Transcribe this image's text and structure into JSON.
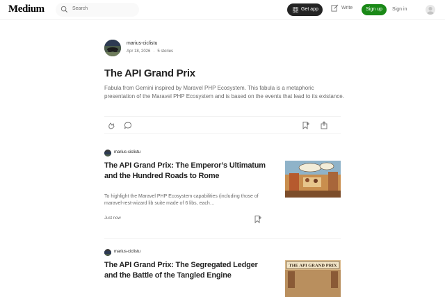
{
  "app": {
    "logo": "Medium",
    "search_placeholder": "Search",
    "get_app_label": "Get app",
    "write_label": "Write",
    "sign_up_label": "Sign up",
    "sign_in_label": "Sign in",
    "accent_color": "#1a8917"
  },
  "list": {
    "author": "marius-ciclistu",
    "date": "Apr 18, 2026",
    "stories_count": "5 stories",
    "title": "The API Grand Prix",
    "description": "Fabula from Gemini inspired by Maravel PHP Ecosystem. This fabula is a metaphoric presentation of the Maravel PHP Ecosystem and is based on the events that lead to its existance."
  },
  "stories": [
    {
      "author": "marius-ciclistu",
      "title": "The API Grand Prix: The Emperor’s Ultimatum and the Hundred Roads to Rome",
      "snippet": "To highlight the Maravel PHP Ecosystem capabilities (including those of maravel-rest-wizard lib suite made of 6 libs, each…",
      "date": "Just now"
    },
    {
      "author": "marius-ciclistu",
      "title": "The API Grand Prix: The Segregated Ledger and the Battle of the Tangled Engine",
      "thumb_caption": "THE API GRAND PRIX"
    }
  ],
  "icons": [
    "search-icon",
    "grid-icon",
    "write-icon",
    "user-icon",
    "clap-icon",
    "comment-icon",
    "bookmark-icon",
    "share-icon"
  ]
}
